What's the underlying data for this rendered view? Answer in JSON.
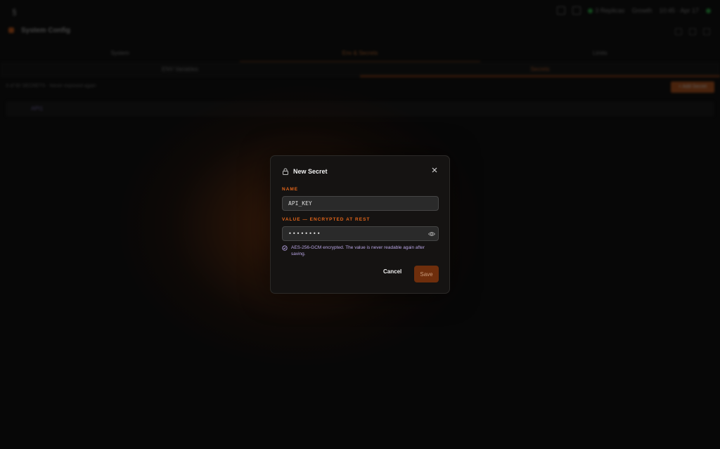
{
  "background": {
    "topbar": {
      "status_replicas": "3 Replicas",
      "status_growth": "Growth",
      "status_time": "10:45 · Apr 17"
    },
    "app_title": "System Config",
    "tabs": [
      {
        "label": "System",
        "active": false
      },
      {
        "label": "Env & Secrets",
        "active": true
      },
      {
        "label": "Limits",
        "active": false
      }
    ],
    "subtabs": [
      {
        "label": "ENV Variables",
        "active": false
      },
      {
        "label": "Secrets",
        "active": true
      }
    ],
    "breadcrumb": "3 of 50 SECRETS · Never exposed again",
    "add_button": "+ Add Secret",
    "row_label": "API1",
    "accent": "#e0641a"
  },
  "modal": {
    "title": "New Secret",
    "name_label": "NAME",
    "name_value": "API_KEY",
    "value_label": "VALUE — ENCRYPTED AT REST",
    "value_value": "••••••••",
    "note": "AES-256-GCM encrypted. The value is never readable again after saving.",
    "cancel_label": "Cancel",
    "save_label": "Save"
  }
}
